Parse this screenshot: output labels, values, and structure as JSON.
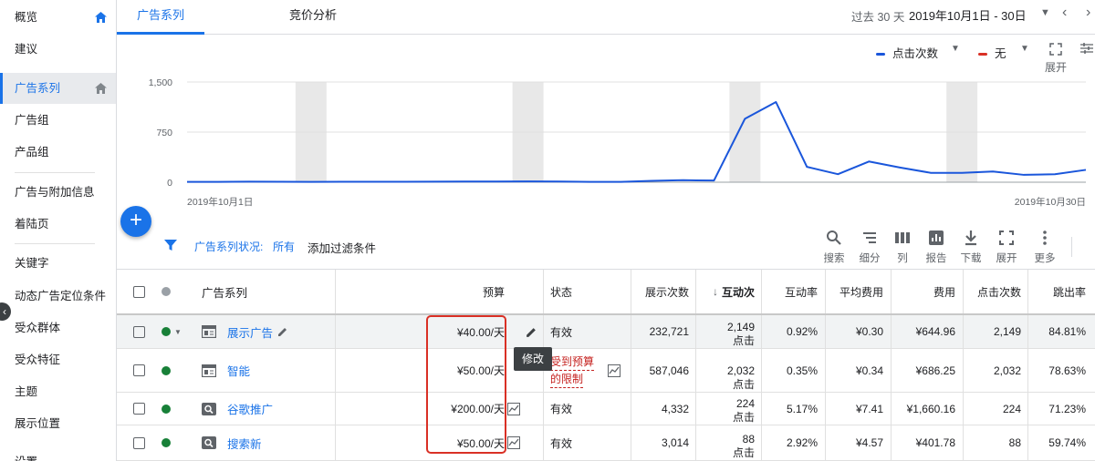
{
  "sidebar": {
    "items": [
      {
        "label": "概览"
      },
      {
        "label": "建议"
      },
      {
        "label": "广告系列"
      },
      {
        "label": "广告组"
      },
      {
        "label": "产品组"
      },
      {
        "label": "广告与附加信息"
      },
      {
        "label": "着陆页"
      },
      {
        "label": "关键字"
      },
      {
        "label": "动态广告定位条件"
      },
      {
        "label": "受众群体"
      },
      {
        "label": "受众特征"
      },
      {
        "label": "主题"
      },
      {
        "label": "展示位置"
      },
      {
        "label": "设置"
      }
    ]
  },
  "tabs": [
    {
      "label": "广告系列"
    },
    {
      "label": "竞价分析"
    }
  ],
  "date": {
    "label": "过去 30 天",
    "range": "2019年10月1日 - 30日"
  },
  "chart_controls": {
    "metric1": "点击次数",
    "metric1_color": "#1a56db",
    "metric2": "无",
    "metric2_color": "#d93025",
    "expand_label": "展开"
  },
  "chart_data": {
    "type": "line",
    "x_start_label": "2019年10月1日",
    "x_end_label": "2019年10月30日",
    "yticks": [
      "0",
      "750",
      "1,500"
    ],
    "ylim": [
      0,
      1500
    ],
    "grid": true,
    "series": [
      {
        "color": "#1a56db",
        "x": [
          1,
          2,
          3,
          4,
          5,
          6,
          7,
          8,
          9,
          10,
          11,
          12,
          13,
          14,
          15,
          16,
          17,
          18,
          19,
          20,
          21,
          22,
          23,
          24,
          25,
          26,
          27,
          28,
          29,
          30
        ],
        "values": [
          5,
          5,
          8,
          6,
          5,
          6,
          7,
          6,
          8,
          10,
          10,
          12,
          10,
          5,
          5,
          20,
          30,
          25,
          950,
          1200,
          230,
          120,
          310,
          220,
          140,
          140,
          160,
          110,
          120,
          185
        ]
      }
    ],
    "weekend_bands": [
      [
        5,
        6
      ],
      [
        12,
        13
      ],
      [
        19,
        20
      ],
      [
        26,
        27
      ]
    ]
  },
  "filter": {
    "label": "广告系列状况:",
    "value": "所有",
    "add": "添加过滤条件"
  },
  "toolbar": {
    "search": "搜索",
    "segment": "细分",
    "columns": "列",
    "reports": "报告",
    "download": "下载",
    "expand": "展开",
    "more": "更多"
  },
  "table": {
    "headers": {
      "campaign": "广告系列",
      "budget": "预算",
      "status": "状态",
      "impr": "展示次数",
      "interactions": "互动次",
      "interaction_rate": "互动率",
      "avg_cost": "平均费用",
      "cost": "费用",
      "clicks": "点击次数",
      "bounce": "跳出率"
    },
    "rows": [
      {
        "name": "展示广告",
        "budget": "¥40.00/天",
        "status": "有效",
        "impr": "232,721",
        "inter_num": "2,149",
        "inter_unit": "点击",
        "rate": "0.92%",
        "avg": "¥0.30",
        "cost": "¥644.96",
        "clicks": "2,149",
        "bounce": "84.81%"
      },
      {
        "name": "智能",
        "budget": "¥50.00/天",
        "status1": "受到预算",
        "status2": "的限制",
        "impr": "587,046",
        "inter_num": "2,032",
        "inter_unit": "点击",
        "rate": "0.35%",
        "avg": "¥0.34",
        "cost": "¥686.25",
        "clicks": "2,032",
        "bounce": "78.63%"
      },
      {
        "name": "谷歌推广",
        "budget": "¥200.00/天",
        "status": "有效",
        "impr": "4,332",
        "inter_num": "224",
        "inter_unit": "点击",
        "rate": "5.17%",
        "avg": "¥7.41",
        "cost": "¥1,660.16",
        "clicks": "224",
        "bounce": "71.23%"
      },
      {
        "name": "搜索新",
        "budget": "¥50.00/天",
        "status": "有效",
        "impr": "3,014",
        "inter_num": "88",
        "inter_unit": "点击",
        "rate": "2.92%",
        "avg": "¥4.57",
        "cost": "¥401.78",
        "clicks": "88",
        "bounce": "59.74%"
      }
    ]
  },
  "tooltip": "修改"
}
